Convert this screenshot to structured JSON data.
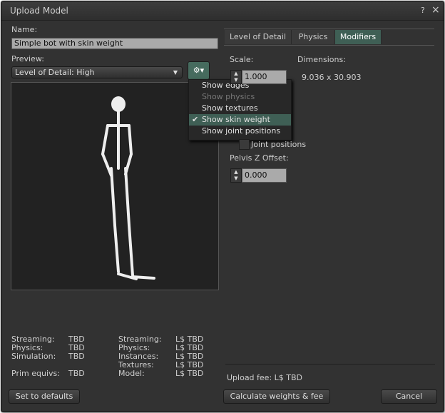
{
  "window": {
    "title": "Upload Model",
    "help": "?",
    "close": "×"
  },
  "name": {
    "label": "Name:",
    "value": "Simple bot with skin weight"
  },
  "preview": {
    "label": "Preview:",
    "lod_select": "Level of Detail: High"
  },
  "gear_menu": {
    "items": [
      {
        "label": "Show edges",
        "enabled": true,
        "checked": false
      },
      {
        "label": "Show physics",
        "enabled": false,
        "checked": false
      },
      {
        "label": "Show textures",
        "enabled": true,
        "checked": false
      },
      {
        "label": "Show skin weight",
        "enabled": true,
        "checked": true
      },
      {
        "label": "Show joint positions",
        "enabled": true,
        "checked": false
      }
    ],
    "check": "✔"
  },
  "tabs": [
    {
      "label": "Level of Detail"
    },
    {
      "label": "Physics"
    },
    {
      "label": "Modifiers",
      "active": true
    }
  ],
  "modifiers": {
    "scale_label": "Scale:",
    "scale_value": "1.000",
    "dimensions_label": "Dimensions:",
    "dimensions_value": "9.036 x 30.903",
    "joint_positions_label": "Joint positions",
    "pelvis_label": "Pelvis Z Offset:",
    "pelvis_value": "0.000"
  },
  "stats": {
    "left": [
      {
        "k": "Streaming:",
        "v": "TBD"
      },
      {
        "k": "Physics:",
        "v": "TBD"
      },
      {
        "k": "Simulation:",
        "v": "TBD"
      },
      {
        "k": "Prim equivs:",
        "v": "TBD"
      }
    ],
    "right": [
      {
        "k": "Streaming:",
        "v": "L$ TBD"
      },
      {
        "k": "Physics:",
        "v": "L$ TBD"
      },
      {
        "k": "Instances:",
        "v": "L$ TBD"
      },
      {
        "k": "Textures:",
        "v": "L$ TBD"
      },
      {
        "k": "Model:",
        "v": "L$ TBD"
      }
    ]
  },
  "upload_fee": "Upload fee: L$ TBD",
  "buttons": {
    "defaults": "Set to defaults",
    "calculate": "Calculate weights & fee",
    "cancel": "Cancel"
  },
  "colors": {
    "accent": "#3f5f55",
    "background": "#323232"
  }
}
